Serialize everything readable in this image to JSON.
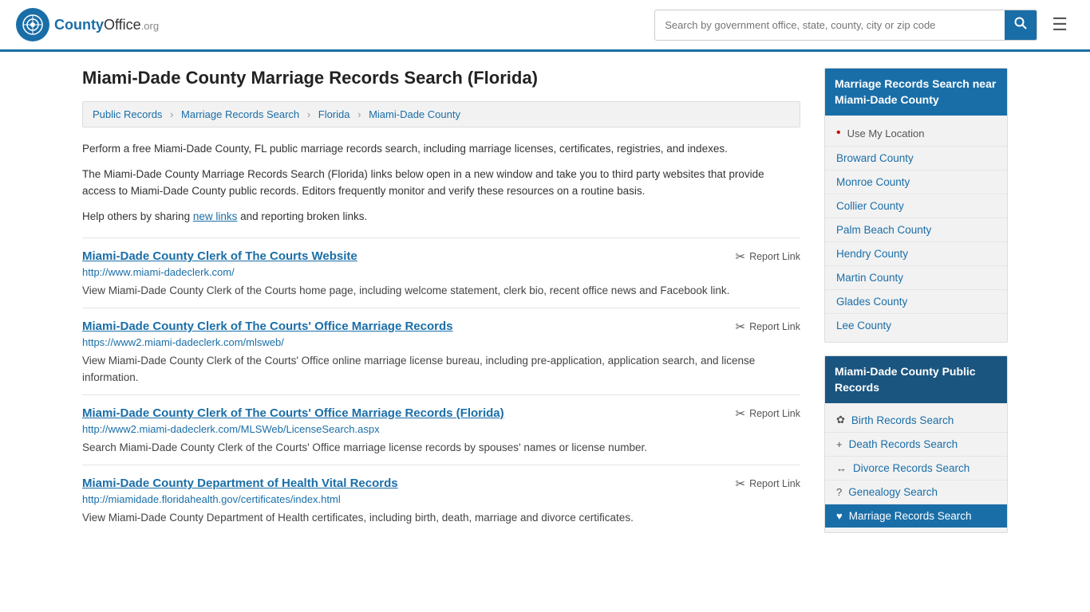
{
  "header": {
    "logo_text": "County",
    "logo_org": "Office",
    "logo_domain": ".org",
    "search_placeholder": "Search by government office, state, county, city or zip code"
  },
  "page": {
    "title": "Miami-Dade County Marriage Records Search (Florida)"
  },
  "breadcrumb": {
    "items": [
      {
        "label": "Public Records",
        "href": "#"
      },
      {
        "label": "Marriage Records Search",
        "href": "#"
      },
      {
        "label": "Florida",
        "href": "#"
      },
      {
        "label": "Miami-Dade County",
        "href": "#"
      }
    ]
  },
  "description": {
    "para1": "Perform a free Miami-Dade County, FL public marriage records search, including marriage licenses, certificates, registries, and indexes.",
    "para2": "The Miami-Dade County Marriage Records Search (Florida) links below open in a new window and take you to third party websites that provide access to Miami-Dade County public records. Editors frequently monitor and verify these resources on a routine basis.",
    "para3_before": "Help others by sharing ",
    "para3_link": "new links",
    "para3_after": " and reporting broken links."
  },
  "results": [
    {
      "title": "Miami-Dade County Clerk of The Courts Website",
      "url": "http://www.miami-dadeclerk.com/",
      "desc": "View Miami-Dade County Clerk of the Courts home page, including welcome statement, clerk bio, recent office news and Facebook link.",
      "report_label": "Report Link"
    },
    {
      "title": "Miami-Dade County Clerk of The Courts' Office Marriage Records",
      "url": "https://www2.miami-dadeclerk.com/mlsweb/",
      "desc": "View Miami-Dade County Clerk of the Courts' Office online marriage license bureau, including pre-application, application search, and license information.",
      "report_label": "Report Link"
    },
    {
      "title": "Miami-Dade County Clerk of The Courts' Office Marriage Records (Florida)",
      "url": "http://www2.miami-dadeclerk.com/MLSWeb/LicenseSearch.aspx",
      "desc": "Search Miami-Dade County Clerk of the Courts' Office marriage license records by spouses' names or license number.",
      "report_label": "Report Link"
    },
    {
      "title": "Miami-Dade County Department of Health Vital Records",
      "url": "http://miamidade.floridahealth.gov/certificates/index.html",
      "desc": "View Miami-Dade County Department of Health certificates, including birth, death, marriage and divorce certificates.",
      "report_label": "Report Link"
    }
  ],
  "sidebar": {
    "nearby_header": "Marriage Records Search near Miami-Dade County",
    "use_location": "Use My Location",
    "nearby_counties": [
      {
        "label": "Broward County"
      },
      {
        "label": "Monroe County"
      },
      {
        "label": "Collier County"
      },
      {
        "label": "Palm Beach County"
      },
      {
        "label": "Hendry County"
      },
      {
        "label": "Martin County"
      },
      {
        "label": "Glades County"
      },
      {
        "label": "Lee County"
      }
    ],
    "public_records_header": "Miami-Dade County Public Records",
    "public_records": [
      {
        "icon": "✿",
        "label": "Birth Records Search"
      },
      {
        "icon": "+",
        "label": "Death Records Search"
      },
      {
        "icon": "↔",
        "label": "Divorce Records Search"
      },
      {
        "icon": "?",
        "label": "Genealogy Search"
      },
      {
        "icon": "♥",
        "label": "Marriage Records Search"
      }
    ]
  }
}
